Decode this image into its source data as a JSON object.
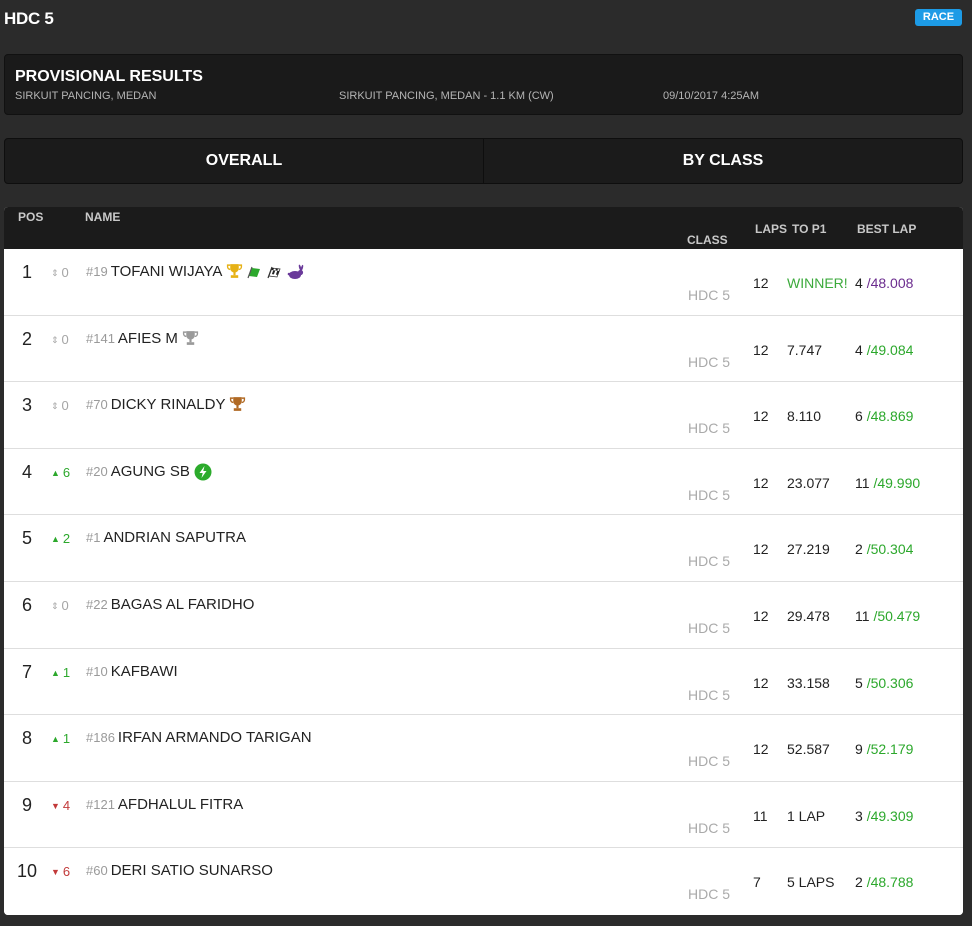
{
  "app": {
    "title": "HDC 5",
    "badge": "RACE"
  },
  "header": {
    "title": "PROVISIONAL RESULTS",
    "venue": "SIRKUIT PANCING, MEDAN",
    "track": "SIRKUIT PANCING, MEDAN - 1.1 KM (CW)",
    "datetime": "09/10/2017 4:25AM"
  },
  "tabs": [
    {
      "label": "OVERALL",
      "active": true
    },
    {
      "label": "BY CLASS",
      "active": false
    }
  ],
  "columns": {
    "pos": "POS",
    "name": "NAME",
    "class": "CLASS",
    "laps": "LAPS",
    "to_p1": "TO P1",
    "best_lap": "BEST LAP"
  },
  "rows": [
    {
      "pos": "1",
      "change": "0",
      "dir": "same",
      "num": "#19",
      "name": "TOFANI WIJAYA",
      "icons": [
        "gold-trophy-icon",
        "green-flag-icon",
        "checkered-flag-icon",
        "rabbit-icon"
      ],
      "class": "HDC 5",
      "laps": "12",
      "gap": "WINNER!",
      "best_lap_no": "4",
      "best_time": "48.008",
      "best_color": "purple"
    },
    {
      "pos": "2",
      "change": "0",
      "dir": "same",
      "num": "#141",
      "name": "AFIES M",
      "icons": [
        "silver-trophy-icon"
      ],
      "class": "HDC 5",
      "laps": "12",
      "gap": "7.747",
      "best_lap_no": "4",
      "best_time": "49.084",
      "best_color": "green"
    },
    {
      "pos": "3",
      "change": "0",
      "dir": "same",
      "num": "#70",
      "name": "DICKY RINALDY",
      "icons": [
        "bronze-trophy-icon"
      ],
      "class": "HDC 5",
      "laps": "12",
      "gap": "8.110",
      "best_lap_no": "6",
      "best_time": "48.869",
      "best_color": "green"
    },
    {
      "pos": "4",
      "change": "6",
      "dir": "up",
      "num": "#20",
      "name": "AGUNG SB",
      "icons": [
        "lightning-icon"
      ],
      "class": "HDC 5",
      "laps": "12",
      "gap": "23.077",
      "best_lap_no": "11",
      "best_time": "49.990",
      "best_color": "green"
    },
    {
      "pos": "5",
      "change": "2",
      "dir": "up",
      "num": "#1",
      "name": "ANDRIAN SAPUTRA",
      "icons": [],
      "class": "HDC 5",
      "laps": "12",
      "gap": "27.219",
      "best_lap_no": "2",
      "best_time": "50.304",
      "best_color": "green"
    },
    {
      "pos": "6",
      "change": "0",
      "dir": "same",
      "num": "#22",
      "name": "BAGAS AL FARIDHO",
      "icons": [],
      "class": "HDC 5",
      "laps": "12",
      "gap": "29.478",
      "best_lap_no": "11",
      "best_time": "50.479",
      "best_color": "green"
    },
    {
      "pos": "7",
      "change": "1",
      "dir": "up",
      "num": "#10",
      "name": "KAFBAWI",
      "icons": [],
      "class": "HDC 5",
      "laps": "12",
      "gap": "33.158",
      "best_lap_no": "5",
      "best_time": "50.306",
      "best_color": "green"
    },
    {
      "pos": "8",
      "change": "1",
      "dir": "up",
      "num": "#186",
      "name": "IRFAN ARMANDO TARIGAN",
      "icons": [],
      "class": "HDC 5",
      "laps": "12",
      "gap": "52.587",
      "best_lap_no": "9",
      "best_time": "52.179",
      "best_color": "green"
    },
    {
      "pos": "9",
      "change": "4",
      "dir": "down",
      "num": "#121",
      "name": "AFDHALUL FITRA",
      "icons": [],
      "class": "HDC 5",
      "laps": "11",
      "gap": "1 LAP",
      "best_lap_no": "3",
      "best_time": "49.309",
      "best_color": "green"
    },
    {
      "pos": "10",
      "change": "6",
      "dir": "down",
      "num": "#60",
      "name": "DERI SATIO SUNARSO",
      "icons": [],
      "class": "HDC 5",
      "laps": "7",
      "gap": "5 LAPS",
      "best_lap_no": "2",
      "best_time": "48.788",
      "best_color": "green"
    }
  ]
}
